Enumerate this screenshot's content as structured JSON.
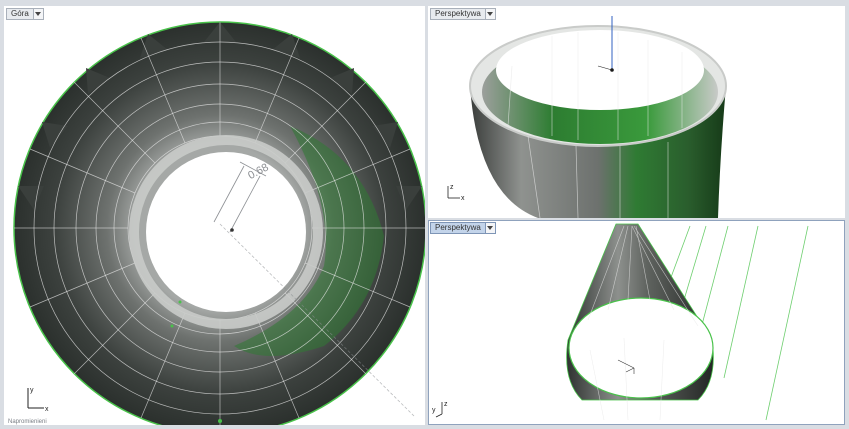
{
  "viewports": {
    "top_left": {
      "label": "Góra"
    },
    "top_right": {
      "label": "Perspektywa"
    },
    "bottom_right": {
      "label": "Perspektywa"
    }
  },
  "dimension": {
    "value": "0.68"
  },
  "axes": {
    "top_left": {
      "x": "x",
      "y": "y"
    },
    "top_right": {
      "x": "x",
      "z": "z"
    },
    "bottom_right": {
      "y": "y",
      "z": "z"
    }
  },
  "status": {
    "text": "Napromienieni"
  },
  "colors": {
    "surface_dark": "#2f3331",
    "surface_mid": "#6c706d",
    "highlight": "#39a13a",
    "edge": "#49c24a",
    "bg": "#ffffff",
    "active_tab": "#c3d4ea"
  }
}
